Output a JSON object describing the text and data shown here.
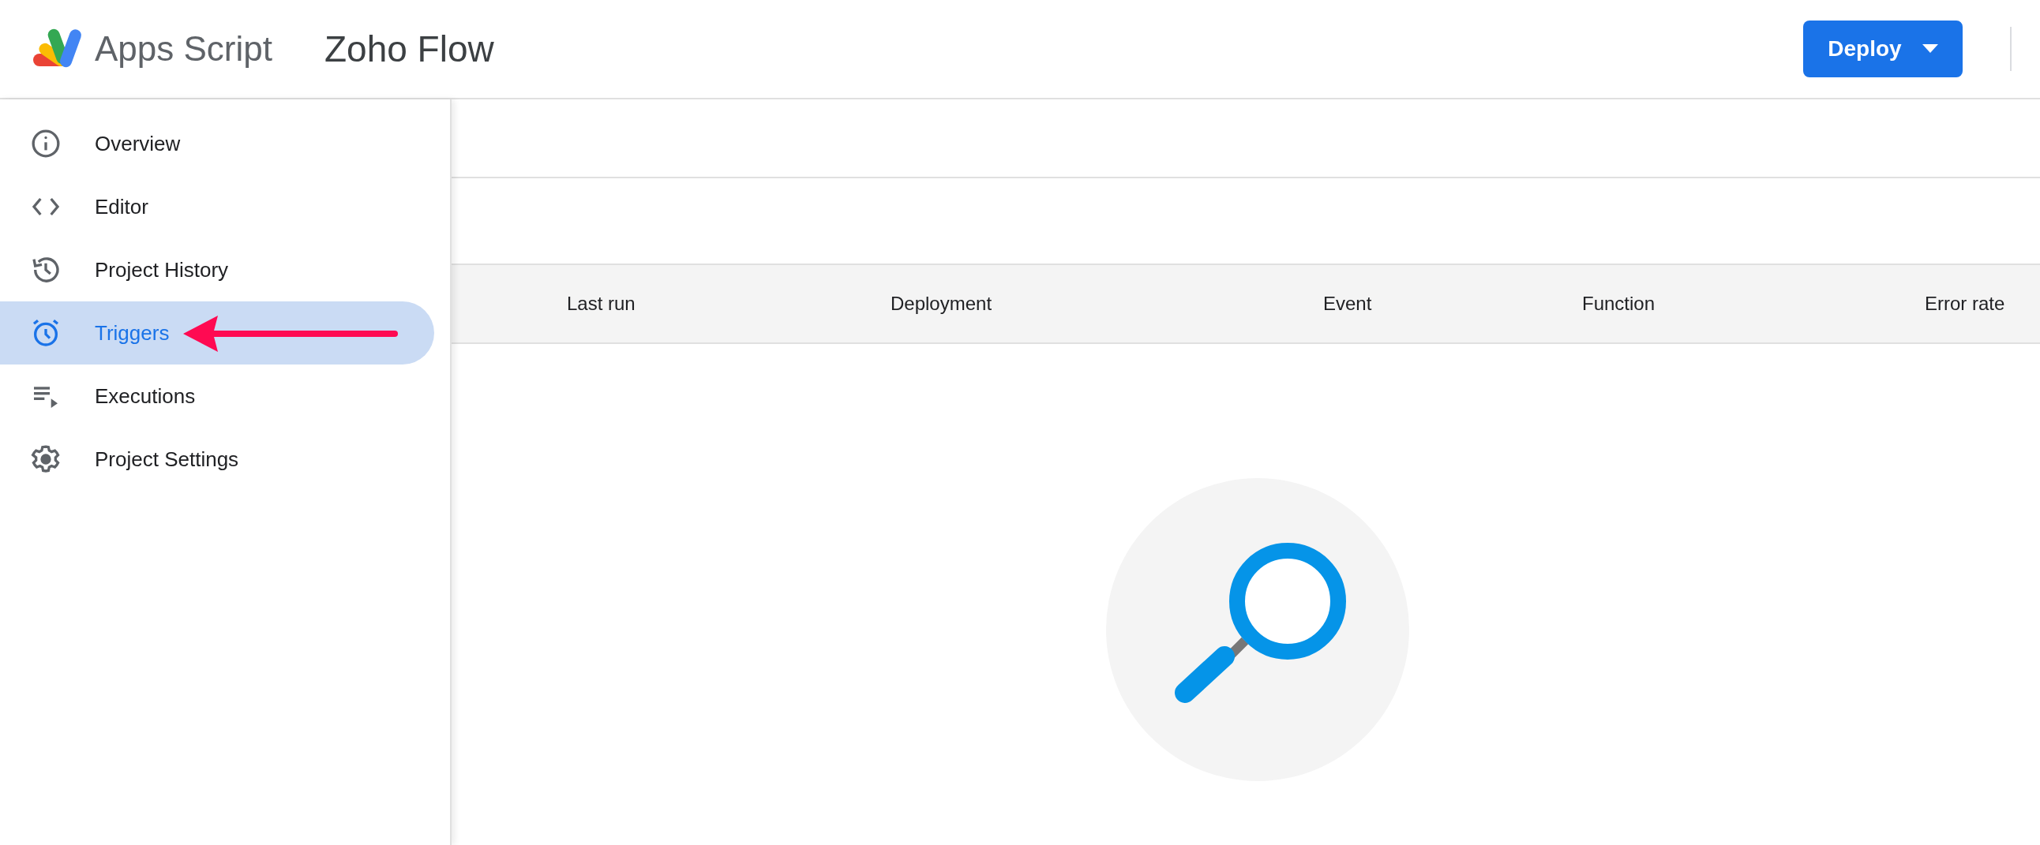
{
  "header": {
    "app_name": "Apps Script",
    "project_title": "Zoho Flow",
    "deploy_button": "Deploy"
  },
  "sidebar": {
    "items": [
      {
        "label": "Overview",
        "selected": false
      },
      {
        "label": "Editor",
        "selected": false
      },
      {
        "label": "Project History",
        "selected": false
      },
      {
        "label": "Triggers",
        "selected": true
      },
      {
        "label": "Executions",
        "selected": false
      },
      {
        "label": "Project Settings",
        "selected": false
      }
    ]
  },
  "table": {
    "columns": [
      "Last run",
      "Deployment",
      "Event",
      "Function",
      "Error rate"
    ]
  }
}
